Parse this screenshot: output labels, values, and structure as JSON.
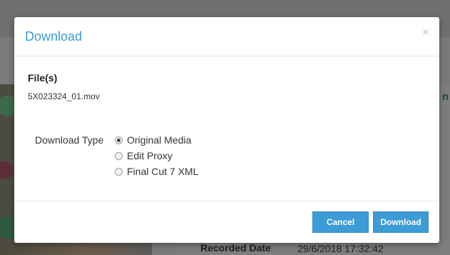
{
  "background": {
    "recorded_label": "Recorded Date",
    "recorded_value": "29/6/2018 17:32:42",
    "side_text": "n"
  },
  "dialog": {
    "title": "Download",
    "close_glyph": "×",
    "files_heading": "File(s)",
    "file_name": "5X023324_01.mov",
    "download_type_label": "Download Type",
    "options": [
      {
        "label": "Original Media",
        "selected": true
      },
      {
        "label": "Edit Proxy",
        "selected": false
      },
      {
        "label": "Final Cut 7 XML",
        "selected": false
      }
    ],
    "cancel_label": "Cancel",
    "download_label": "Download"
  },
  "colors": {
    "accent": "#3d9bd5",
    "overlay": "#7a7a7a"
  }
}
